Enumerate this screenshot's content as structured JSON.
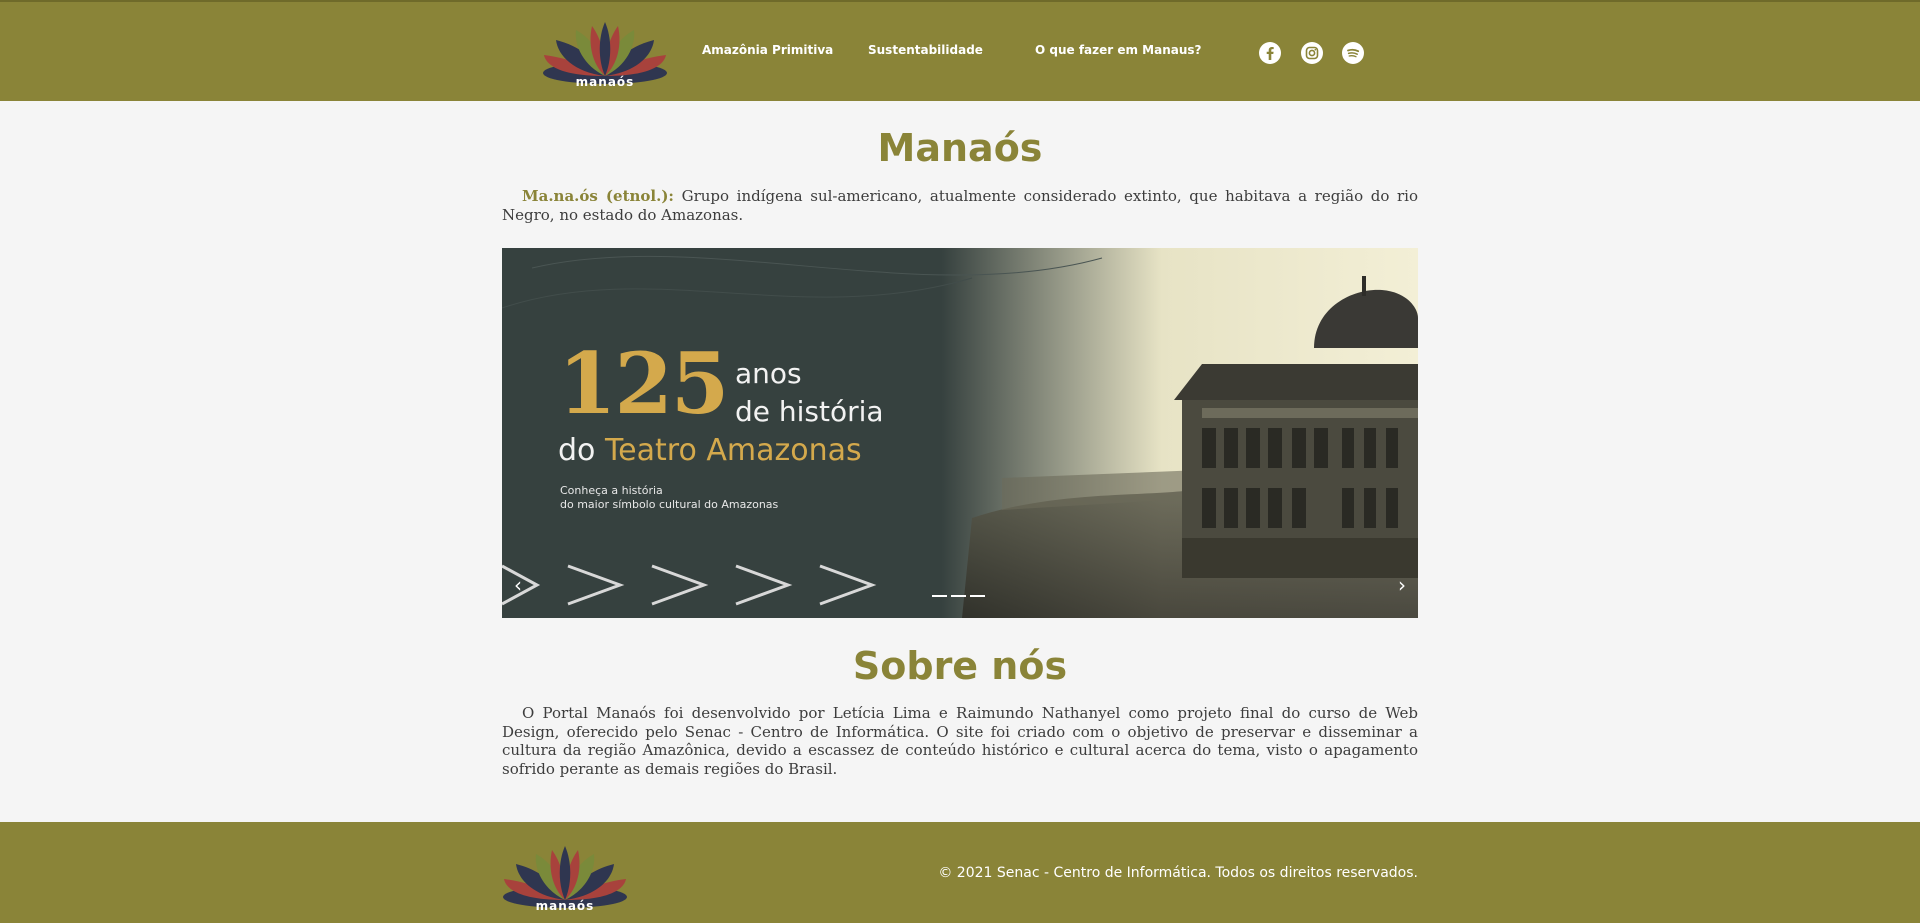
{
  "brand": {
    "name": "manaós"
  },
  "colors": {
    "olive": "#8a8438",
    "gold": "#d4a94c",
    "dark_slate": "#36413f",
    "background": "#f5f5f5"
  },
  "nav": {
    "items": [
      {
        "label": "Amazônia Primitiva"
      },
      {
        "label": "Sustentabilidade"
      },
      {
        "label": "O que fazer em Manaus?"
      }
    ],
    "social_icons": [
      "facebook-icon",
      "instagram-icon",
      "spotify-icon"
    ]
  },
  "intro": {
    "title": "Manaós",
    "term": "Ma.na.ós (etnol.):",
    "definition": " Grupo indígena sul-americano, atualmente considerado extinto, que habitava a região do rio Negro, no estado do Amazonas."
  },
  "carousel": {
    "number": "125",
    "line1": "anos",
    "line2": "de história",
    "line3_prefix": "do ",
    "line3_highlight": "Teatro Amazonas",
    "sub1": "Conheça a história",
    "sub2": "do maior símbolo cultural do Amazonas",
    "prev_symbol": "‹",
    "next_symbol": "›",
    "slide_count": 3
  },
  "about": {
    "title": "Sobre nós",
    "text": "O Portal Manaós foi desenvolvido por Letícia Lima e Raimundo Nathanyel como projeto final do curso de Web Design, oferecido pelo Senac - Centro de Informática. O site foi criado com o objetivo de preservar e disseminar a cultura da região Amazônica, devido a escassez de conteúdo histórico e cultural acerca do tema, visto o apagamento sofrido perante as demais regiões do Brasil."
  },
  "footer": {
    "copyright": "© 2021 Senac - Centro de Informática. Todos os direitos reservados."
  }
}
